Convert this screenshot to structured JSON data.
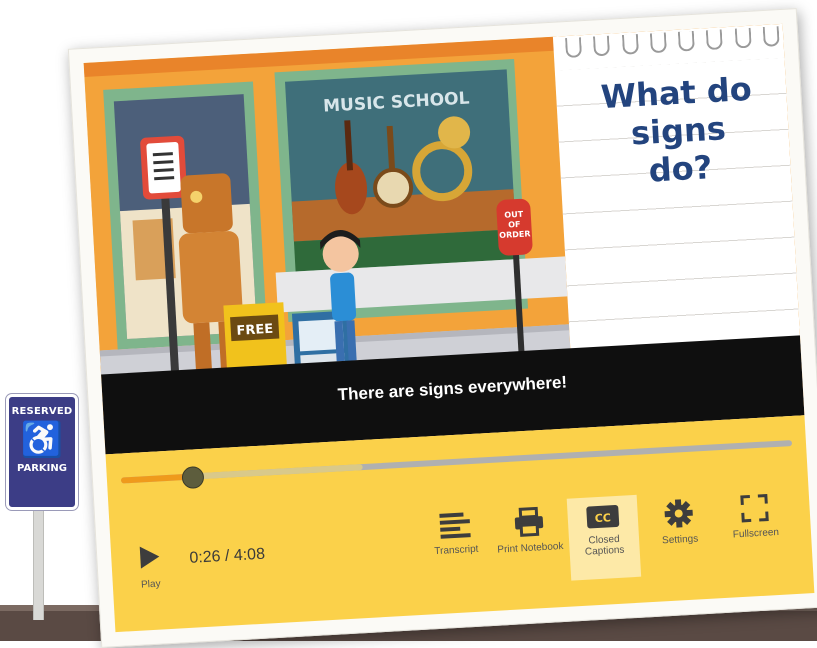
{
  "parking_sign": {
    "top": "RESERVED",
    "bottom": "PARKING",
    "icon": "wheelchair-icon"
  },
  "scene": {
    "store_sign": "MUSIC SCHOOL",
    "box_sign": "FREE",
    "meter_sign_lines": [
      "OUT",
      "OF",
      "ORDER"
    ]
  },
  "notebook": {
    "title_lines": [
      "What do",
      "signs",
      "do?"
    ]
  },
  "caption": "There are signs everywhere!",
  "player": {
    "current_time": "0:26",
    "duration": "4:08",
    "time_display": "0:26 / 4:08",
    "progress_fraction": 0.105,
    "buffered_fraction": 0.36,
    "play_label": "Play",
    "transcript_label": "Transcript",
    "print_label": "Print Notebook",
    "cc_label": "Closed Captions",
    "settings_label": "Settings",
    "fullscreen_label": "Fullscreen"
  },
  "colors": {
    "control_bar": "#fbd14a",
    "caption_bg": "#0f0f0f",
    "title_ink": "#23447e",
    "scene_orange": "#f3a33a"
  }
}
